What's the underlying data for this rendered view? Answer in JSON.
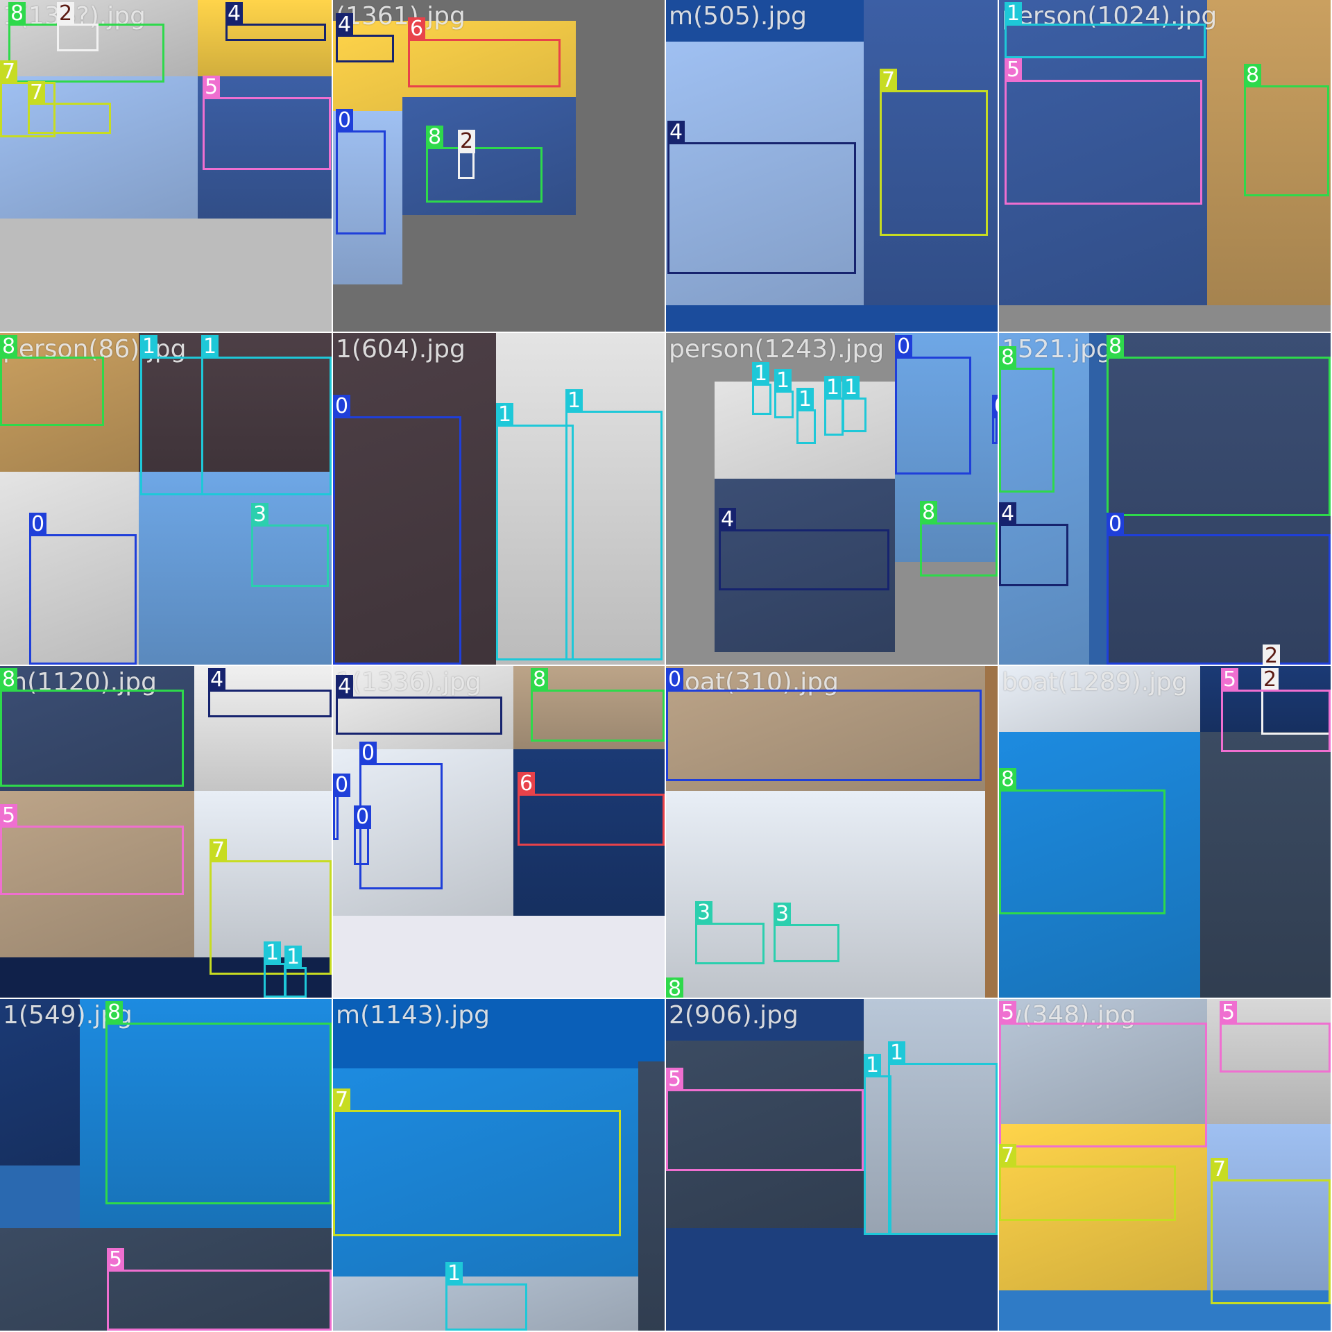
{
  "mosaic": {
    "tiles": [
      {
        "filename": "1(136?).jpg",
        "labels": [
          "8",
          "2",
          "4",
          "7",
          "7",
          "5"
        ]
      },
      {
        "filename": "(1361).jpg",
        "labels": [
          "4",
          "6",
          "0",
          "8",
          "2"
        ]
      },
      {
        "filename": "m(505).jpg",
        "labels": [
          "4",
          "7"
        ]
      },
      {
        "filename": "person(1024).jpg",
        "labels": [
          "1",
          "5",
          "8"
        ]
      },
      {
        "filename": "person(86).jpg",
        "labels": [
          "8",
          "1",
          "1",
          "0",
          "3"
        ]
      },
      {
        "filename": "1(604).jpg",
        "labels": [
          "0",
          "1",
          "1"
        ]
      },
      {
        "filename": "person(1243).jpg",
        "labels": [
          "1",
          "1",
          "1",
          "1",
          "1",
          "0",
          "0",
          "4",
          "8"
        ]
      },
      {
        "filename": "1521.jpg",
        "labels": [
          "8",
          "8",
          "4",
          "0",
          "2"
        ]
      },
      {
        "filename": "m(1120).jpg",
        "labels": [
          "8",
          "4",
          "5",
          "7",
          "1",
          "1"
        ]
      },
      {
        "filename": "1(1336).jpg",
        "labels": [
          "8",
          "4",
          "0",
          "0",
          "0",
          "6"
        ]
      },
      {
        "filename": "boat(310).jpg",
        "labels": [
          "0",
          "3",
          "3",
          "8"
        ]
      },
      {
        "filename": "boat(1289).jpg",
        "labels": [
          "2",
          "8",
          "5"
        ]
      },
      {
        "filename": "1(549).jpg",
        "labels": [
          "8",
          "5"
        ]
      },
      {
        "filename": "m(1143).jpg",
        "labels": [
          "7",
          "1"
        ]
      },
      {
        "filename": "2(906).jpg",
        "labels": [
          "5",
          "1",
          "1"
        ]
      },
      {
        "filename": "w(348).jpg",
        "labels": [
          "5",
          "5",
          "7",
          "7"
        ]
      }
    ],
    "class_colors": {
      "0": "#1f3fd9",
      "1": "#1ec8d8",
      "2": "#f2f2f2",
      "3": "#2bcfae",
      "4": "#16236e",
      "5": "#ef6fd0",
      "6": "#e8424a",
      "7": "#c7dc22",
      "8": "#2ed94b"
    },
    "tile_backgrounds": [
      "#bcbcbc",
      "#6e6e6e",
      "#1b4c9c",
      "#8a8a8a",
      "#2a5d9a",
      "#b07a5d",
      "#8e8e8e",
      "#2f61a6",
      "#10214a",
      "#e8e8f0",
      "#9f7347",
      "#2468b9",
      "#2a69b0",
      "#0a5fb8",
      "#1d3f7d",
      "#2f7bc6"
    ],
    "image_fill_colors": [
      "#d8d8d8",
      "#ffd44a",
      "#9fc0f2",
      "#3c5fa5",
      "#caa060",
      "#4d3f46",
      "#e4e4e4",
      "#6ea7e6",
      "#3b4e74",
      "#f0f0f0",
      "#bca488",
      "#e8eef6",
      "#1b3a75",
      "#1d8be0",
      "#3b4b62",
      "#b9c7d8"
    ]
  }
}
